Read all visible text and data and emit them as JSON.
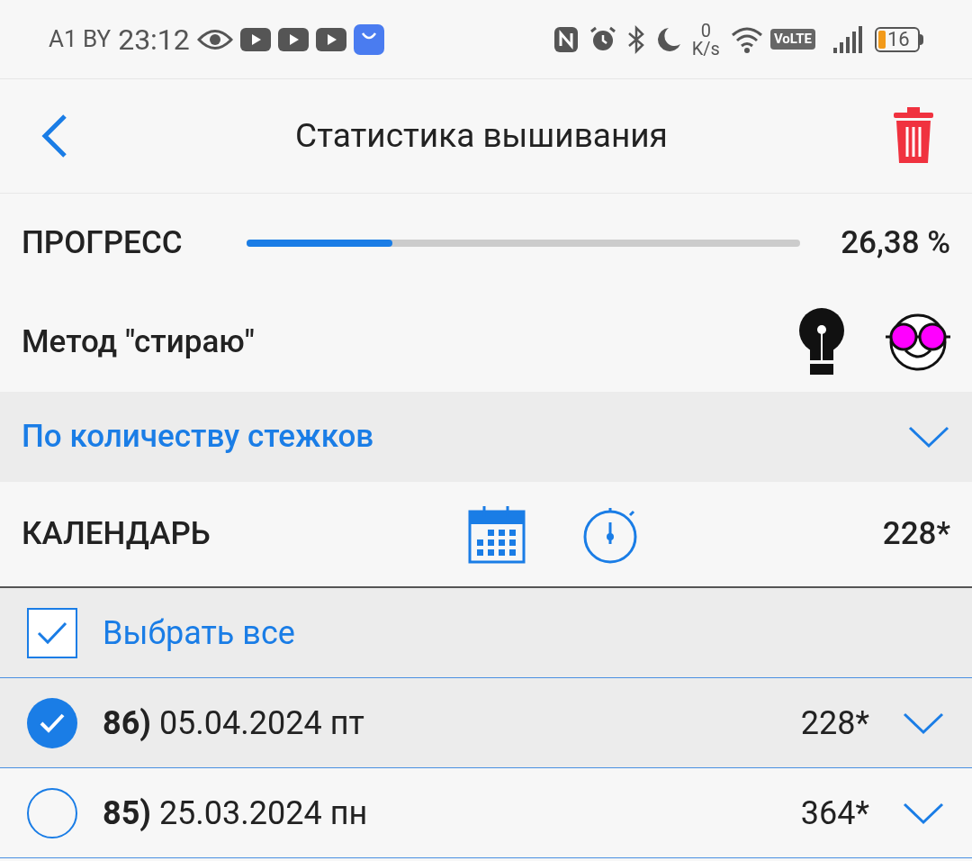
{
  "status_bar": {
    "carrier": "A1 BY",
    "time": "23:12",
    "speed_value": "0",
    "speed_unit": "K/s",
    "volte": "VoLTE",
    "battery": "16"
  },
  "header": {
    "title": "Статистика вышивания"
  },
  "progress": {
    "label": "ПРОГРЕСС",
    "level": 0.264,
    "value": "26,38 %"
  },
  "method": {
    "label": "Метод \"стираю\""
  },
  "mode_dropdown": {
    "value": "По количеству стежков",
    "expanded": false
  },
  "calendar": {
    "label": "КАЛЕНДАРЬ",
    "total": "228*"
  },
  "select_all": {
    "label": "Выбрать все",
    "checked": true
  },
  "entries": [
    {
      "title": "**86)** 05.04.2024 пт",
      "count": "228*",
      "selected": true
    },
    {
      "title": "**85)** 25.03.2024 пн",
      "count": "364*",
      "selected": false
    }
  ]
}
